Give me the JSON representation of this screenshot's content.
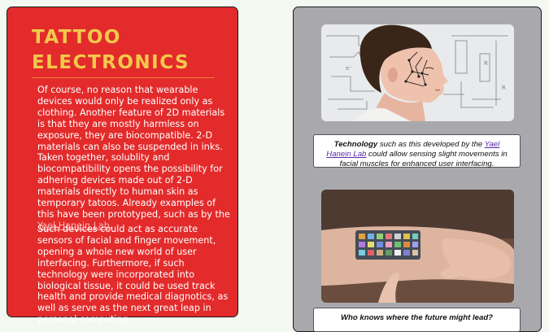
{
  "article": {
    "title_line1": "TATTOO",
    "title_line2": "ELECTRONICS",
    "paragraph1_text": "Of course, no reason that wearable devices would only be realized only as clothing. Another feature of 2D materials is that they are mostly harmless on exposure, they are biocompatible. 2-D materials can also be suspended in inks. Taken together, solublity and biocompatibility opens the possibility for adhering devices made out of 2-D materials directly to human skin as temporary tatoos. Already examples of this have been prototyped, such as by the ",
    "paragraph1_link": "Yael Hanein Lab",
    "paragraph1_end": ".",
    "paragraph2": "Such devices could act as accurate sensors of facial and finger movement, opening a whole new world of user interfacing. Furthermore, if such technology were incorporated into biological tissue, it could be used track health and provide medical diagnotics, as well as serve as the next great leap in personal computing."
  },
  "sidebar": {
    "caption1_bold": "Technology",
    "caption1_pre": " such as this developed by the ",
    "caption1_link": "Yael Hanein Lab",
    "caption1_post": " could allow sensing slight movements in facial muscles for enhanced user interfacing.",
    "caption2": "Who knows where the future might lead?"
  },
  "colors": {
    "card_red": "#e32b2b",
    "title_yellow": "#f2c94c",
    "panel_gray": "#a9a9ad",
    "link_purple": "#5a2aa6"
  }
}
